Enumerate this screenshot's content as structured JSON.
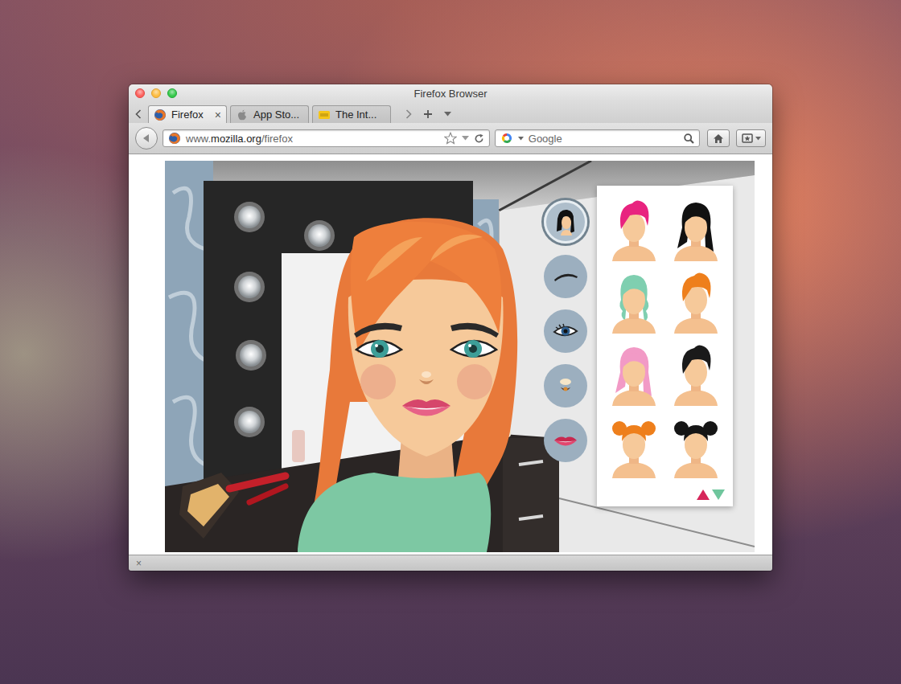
{
  "window": {
    "title": "Firefox Browser"
  },
  "tabs": [
    {
      "label": "Firefox",
      "selected": true,
      "kind": "firefox",
      "close": "×"
    },
    {
      "label": "App Sto...",
      "selected": false,
      "kind": "apple",
      "close": ""
    },
    {
      "label": "The Int...",
      "selected": false,
      "kind": "imdb",
      "close": ""
    }
  ],
  "address_bar": {
    "prefix": "www.",
    "domain": "mozilla.org",
    "path": "/firefox"
  },
  "search": {
    "placeholder": "Google"
  },
  "game": {
    "tools": [
      {
        "kind": "hair",
        "selected": true
      },
      {
        "kind": "eyebrow",
        "selected": false
      },
      {
        "kind": "eye",
        "selected": false
      },
      {
        "kind": "nose",
        "selected": false
      },
      {
        "kind": "lips",
        "selected": false
      }
    ],
    "hairstyles": [
      {
        "kind": "short",
        "color": "#e8237f"
      },
      {
        "kind": "long",
        "color": "#111111"
      },
      {
        "kind": "wavy",
        "color": "#7fcfb0"
      },
      {
        "kind": "short",
        "color": "#ee7f1c"
      },
      {
        "kind": "long",
        "color": "#f29ac6"
      },
      {
        "kind": "short",
        "color": "#1a1a1a"
      },
      {
        "kind": "buns",
        "color": "#ee7f1c"
      },
      {
        "kind": "buns",
        "color": "#151515"
      }
    ]
  },
  "status_bar": {
    "close": "×"
  }
}
